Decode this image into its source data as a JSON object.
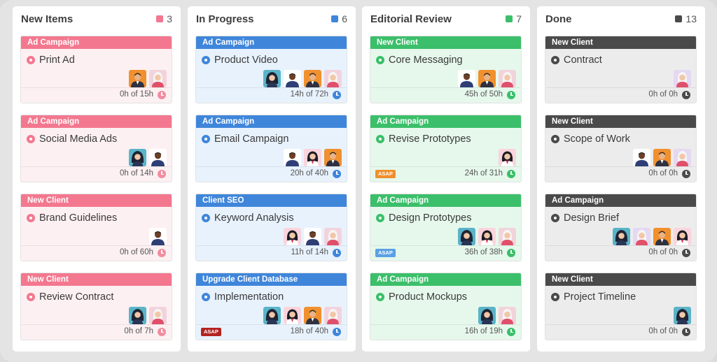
{
  "colors": {
    "pink": "#f3788f",
    "pink_bg": "#fdf0f2",
    "pink_clock": "#ef8ea0",
    "blue": "#3f86db",
    "blue_bg": "#e8f2fd",
    "blue_clock": "#3f86db",
    "green": "#3bbf6a",
    "green_bg": "#e6f8ec",
    "green_clock": "#3bbf6a",
    "dark": "#4a4a4a",
    "dark_bg": "#ececec",
    "dark_clock": "#4a4a4a",
    "asap_orange": "#f0902e",
    "asap_blue": "#5aa0e6",
    "asap_red": "#b42323"
  },
  "columns": [
    {
      "title": "New Items",
      "count": "3",
      "cards": [
        {
          "tag": "Ad Campaign",
          "name": "Print Ad",
          "hours": "0h of 15h",
          "avatars": [
            "man-orange-avatar",
            "woman-white-hair-avatar"
          ]
        },
        {
          "tag": "Ad Campaign",
          "name": "Social Media Ads",
          "hours": "0h of 14h",
          "avatars": [
            "woman-dark-hair-avatar",
            "man-dark-skin-avatar"
          ]
        },
        {
          "tag": "New Client",
          "name": "Brand Guidelines",
          "hours": "0h of 60h",
          "avatars": [
            "man-dark-skin-avatar"
          ]
        },
        {
          "tag": "New Client",
          "name": "Review Contract",
          "hours": "0h of 7h",
          "avatars": [
            "woman-dark-hair-avatar",
            "woman-white-hair-avatar"
          ]
        }
      ]
    },
    {
      "title": "In Progress",
      "count": "6",
      "cards": [
        {
          "tag": "Ad Campaign",
          "name": "Product Video",
          "hours": "14h of 72h",
          "avatars": [
            "woman-dark-hair-avatar",
            "man-dark-skin-avatar",
            "man-orange-avatar",
            "woman-white-hair-avatar"
          ]
        },
        {
          "tag": "Ad Campaign",
          "name": "Email Campaign",
          "hours": "20h of 40h",
          "avatars": [
            "man-dark-skin-avatar",
            "woman-pink-avatar",
            "man-orange-avatar"
          ]
        },
        {
          "tag": "Client SEO",
          "name": "Keyword Analysis",
          "hours": "11h of 14h",
          "avatars": [
            "woman-pink-avatar",
            "man-dark-skin-avatar",
            "woman-white-hair-avatar"
          ]
        },
        {
          "tag": "Upgrade Client Database",
          "name": "Implementation",
          "hours": "18h of 40h",
          "asap": "ASAP",
          "avatars": [
            "woman-dark-hair-avatar",
            "woman-pink-avatar",
            "man-orange-avatar",
            "woman-white-hair-avatar"
          ]
        }
      ]
    },
    {
      "title": "Editorial Review",
      "count": "7",
      "cards": [
        {
          "tag": "New Client",
          "name": "Core Messaging",
          "hours": "45h of 50h",
          "avatars": [
            "man-dark-skin-avatar",
            "man-orange-avatar",
            "woman-white-hair-avatar"
          ]
        },
        {
          "tag": "Ad Campaign",
          "name": "Revise Prototypes",
          "hours": "24h of 31h",
          "asap": "ASAP",
          "avatars": [
            "woman-pink-avatar"
          ]
        },
        {
          "tag": "Ad Campaign",
          "name": "Design Prototypes",
          "hours": "36h of 38h",
          "asap": "ASAP",
          "avatars": [
            "woman-dark-hair-avatar",
            "woman-pink-avatar",
            "woman-white-hair-avatar"
          ]
        },
        {
          "tag": "Ad Campaign",
          "name": "Product Mockups",
          "hours": "16h of 19h",
          "avatars": [
            "woman-dark-hair-avatar",
            "woman-white-hair-avatar"
          ]
        }
      ]
    },
    {
      "title": "Done",
      "count": "13",
      "cards": [
        {
          "tag": "New Client",
          "name": "Contract",
          "hours": "0h of 0h",
          "avatars": [
            "woman-white-hair-avatar"
          ]
        },
        {
          "tag": "New Client",
          "name": "Scope of Work",
          "hours": "0h of 0h",
          "avatars": [
            "man-dark-skin-avatar",
            "man-orange-avatar",
            "woman-white-hair-avatar"
          ]
        },
        {
          "tag": "Ad Campaign",
          "name": "Design Brief",
          "hours": "0h of 0h",
          "avatars": [
            "woman-dark-hair-avatar",
            "woman-white-hair-avatar",
            "man-orange-avatar",
            "woman-pink-avatar"
          ]
        },
        {
          "tag": "New Client",
          "name": "Project Timeline",
          "hours": "0h of 0h",
          "avatars": [
            "woman-dark-hair-avatar"
          ]
        }
      ]
    }
  ]
}
